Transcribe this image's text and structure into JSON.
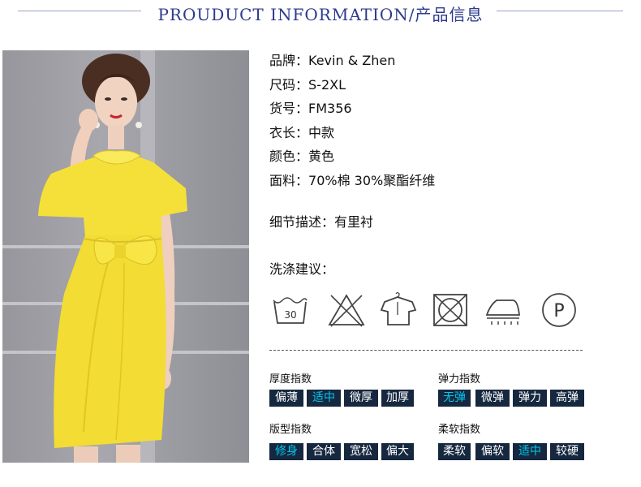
{
  "header": {
    "title": "PROUDUCT INFORMATION/产品信息"
  },
  "info": [
    {
      "label": "品牌：",
      "value": "Kevin & Zhen"
    },
    {
      "label": "尺码：",
      "value": "S-2XL"
    },
    {
      "label": "货号：",
      "value": "FM356"
    },
    {
      "label": "衣长：",
      "value": "中款"
    },
    {
      "label": "颜色：",
      "value": "黄色"
    },
    {
      "label": "面料：",
      "value": "70%棉 30%聚酯纤维"
    }
  ],
  "detail": {
    "label": "细节描述：",
    "value": "有里衬"
  },
  "washing": {
    "label": "洗涤建议：",
    "icons": [
      {
        "name": "wash-30-icon",
        "text": "30"
      },
      {
        "name": "do-not-bleach-icon"
      },
      {
        "name": "hang-dry-icon"
      },
      {
        "name": "do-not-tumble-dry-icon"
      },
      {
        "name": "iron-icon"
      },
      {
        "name": "dry-clean-p-icon",
        "text": "P"
      }
    ]
  },
  "indices": [
    {
      "title": "厚度指数",
      "options": [
        "偏薄",
        "适中",
        "微厚",
        "加厚"
      ],
      "active": 1
    },
    {
      "title": "弹力指数",
      "options": [
        "无弹",
        "微弹",
        "弹力",
        "高弹"
      ],
      "active": 0
    },
    {
      "title": "版型指数",
      "options": [
        "修身",
        "合体",
        "宽松",
        "偏大"
      ],
      "active": 0
    },
    {
      "title": "柔软指数",
      "options": [
        "柔软",
        "偏软",
        "适中",
        "较硬"
      ],
      "active": 2
    }
  ],
  "colors": {
    "title": "#2d3a8c",
    "chip_bg": "#16283f",
    "chip_text": "#ffffff",
    "chip_active": "#00c8f0",
    "dress": "#f5e03a"
  }
}
